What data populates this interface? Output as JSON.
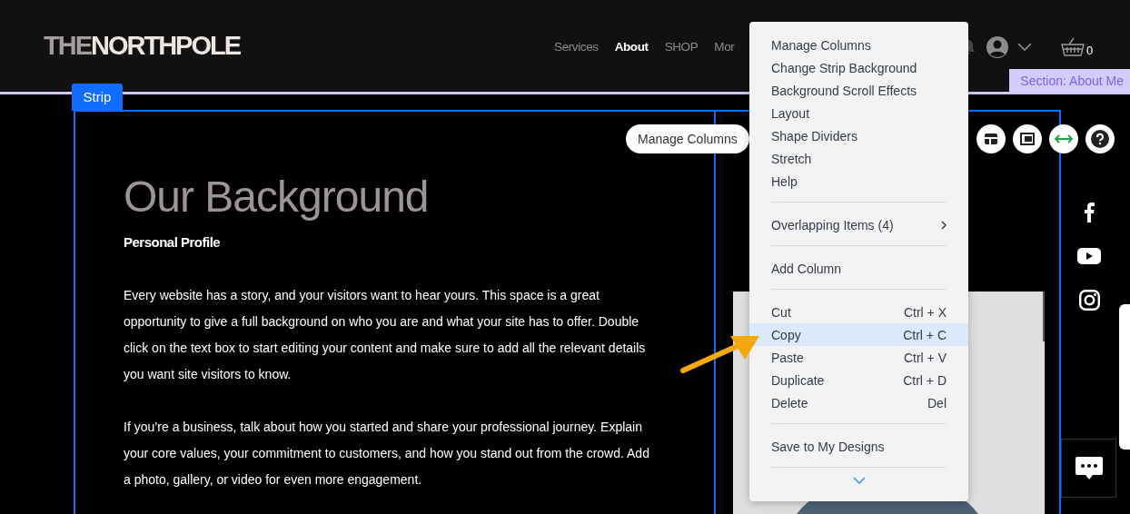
{
  "header": {
    "logo": {
      "prefix": "THE",
      "main": "NORTHPOLE"
    },
    "nav": [
      {
        "label": "Services",
        "selected": false
      },
      {
        "label": "About",
        "selected": true
      },
      {
        "label": "SHOP",
        "selected": false
      },
      {
        "label": "Mor",
        "selected": false
      }
    ],
    "cart_count": "0"
  },
  "section_label": "Section: About Me",
  "strip_label": "Strip",
  "toolbar": {
    "button": "Manage Columns"
  },
  "content": {
    "title": "Our Background",
    "subtitle": "Personal Profile",
    "paragraphs": [
      "Every website has a story, and your visitors want to hear yours. This space is a great opportunity to give a full background on who you are and what your site has to offer. Double click on the text box to start editing your content and make sure to add all the relevant details you want site visitors to know.",
      "If you’re a business, talk about how you started and share your professional journey. Explain your core values, your commitment to customers, and how you stand out from the crowd. Add a photo, gallery, or video for even more engagement."
    ]
  },
  "context_menu": {
    "sections": [
      [
        {
          "label": "Manage Columns",
          "kind": "command",
          "selected": false
        },
        {
          "label": "Change Strip Background",
          "kind": "command",
          "selected": false
        },
        {
          "label": "Background Scroll Effects",
          "kind": "command",
          "selected": false
        },
        {
          "label": "Layout",
          "kind": "command",
          "selected": false
        },
        {
          "label": "Shape Dividers",
          "kind": "command",
          "selected": false
        },
        {
          "label": "Stretch",
          "kind": "command",
          "selected": false
        },
        {
          "label": "Help",
          "kind": "command",
          "selected": false
        }
      ],
      [
        {
          "label": "Overlapping Items (4)",
          "kind": "submenu",
          "selected": false
        }
      ],
      [
        {
          "label": "Add Column",
          "kind": "command",
          "selected": false
        }
      ],
      [
        {
          "label": "Cut",
          "shortcut": "Ctrl + X",
          "kind": "command",
          "selected": false
        },
        {
          "label": "Copy",
          "shortcut": "Ctrl + C",
          "kind": "command",
          "selected": true
        },
        {
          "label": "Paste",
          "shortcut": "Ctrl + V",
          "kind": "command",
          "selected": false
        },
        {
          "label": "Duplicate",
          "shortcut": "Ctrl + D",
          "kind": "command",
          "selected": false
        },
        {
          "label": "Delete",
          "shortcut": "Del",
          "kind": "command",
          "selected": false
        }
      ],
      [
        {
          "label": "Save to My Designs",
          "kind": "command",
          "selected": false
        }
      ]
    ]
  }
}
